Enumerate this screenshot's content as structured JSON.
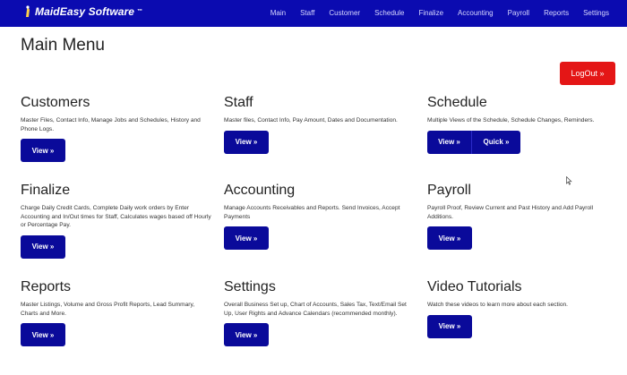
{
  "brand": {
    "name": "MaidEasy Software",
    "tm": "™"
  },
  "nav": [
    "Main",
    "Staff",
    "Customer",
    "Schedule",
    "Finalize",
    "Accounting",
    "Payroll",
    "Reports",
    "Settings"
  ],
  "page": {
    "title": "Main Menu",
    "logout_label": "LogOut »"
  },
  "sections": {
    "customers": {
      "title": "Customers",
      "desc": "Master Files, Contact Info, Manage Jobs and Schedules, History and Phone Logs.",
      "view": "View »"
    },
    "staff": {
      "title": "Staff",
      "desc": "Master files, Contact Info, Pay Amount, Dates and Documentation.",
      "view": "View »"
    },
    "schedule": {
      "title": "Schedule",
      "desc": "Multiple Views of the Schedule, Schedule Changes, Reminders.",
      "view": "View »",
      "quick": "Quick »"
    },
    "finalize": {
      "title": "Finalize",
      "desc": "Charge Daily Credit Cards, Complete Daily work orders by Enter Accounting and In/Out times for Staff, Calculates wages based off Hourly or Percentage Pay.",
      "view": "View »"
    },
    "accounting": {
      "title": "Accounting",
      "desc": "Manage Accounts Receivables and Reports. Send Invoices, Accept Payments",
      "view": "View »"
    },
    "payroll": {
      "title": "Payroll",
      "desc": "Payroll Proof, Review Current and Past History and Add Payroll Additions.",
      "view": "View »"
    },
    "reports": {
      "title": "Reports",
      "desc": "Master Listings, Volume and Gross Profit Reports, Lead Summary, Charts and More.",
      "view": "View »"
    },
    "settings": {
      "title": "Settings",
      "desc": "Overall Business Set up, Chart of Accounts, Sales Tax, Text/Email Set Up, User Rights and Advance Calendars (recommended monthly).",
      "view": "View »"
    },
    "video_tutorials": {
      "title": "Video Tutorials",
      "desc": "Watch these videos to learn more about each section.",
      "view": "View »"
    }
  },
  "colors": {
    "navbar": "#0b0bb0",
    "button": "#0a0a9a",
    "logout": "#e41616"
  }
}
